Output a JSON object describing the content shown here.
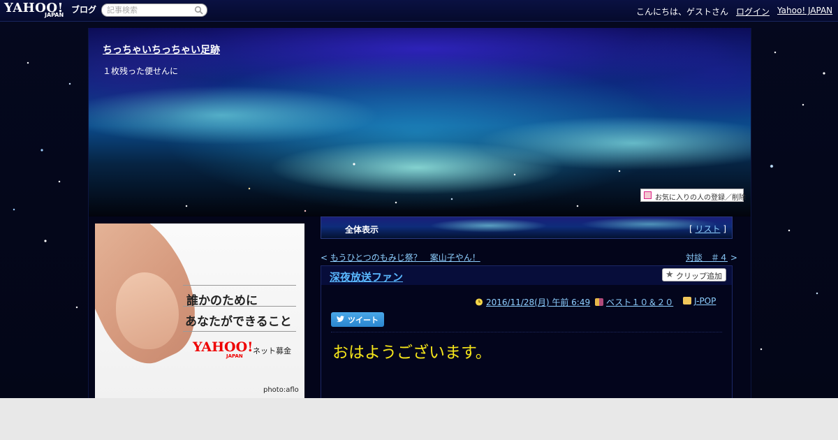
{
  "topbar": {
    "logo_text": "YAHOO!",
    "logo_sub": "JAPAN",
    "logo_blog": "ブログ",
    "search_placeholder": "記事検索",
    "greeting": "こんにちは、ゲストさん",
    "login": "ログイン",
    "yahoo_japan": "Yahoo! JAPAN"
  },
  "header": {
    "blog_title": "ちっちゃいちっちゃい足跡",
    "blog_subtitle": "１枚残った便せんに",
    "favorite_button": "お気に入りの人の登録／削除"
  },
  "ad": {
    "line1": "誰かのために",
    "line2": "あなたができること",
    "logo": "YAHOO!",
    "logo_sub": "JAPAN",
    "service": "ネット募金",
    "credit": "photo:aflo"
  },
  "nav": {
    "all_label": "全体表示",
    "list_open": "[",
    "list_label": "リスト",
    "list_close": "]"
  },
  "pager": {
    "prev_mark": "<",
    "prev": "もうひとつのもみじ祭？　案山子やん！",
    "next": "対談　＃４",
    "next_mark": ">"
  },
  "post": {
    "title": "深夜放送ファン",
    "clip_button": "クリップ追加",
    "date": "2016/11/28(月) 午前 6:49",
    "category": "ベスト１０＆２０",
    "genre": "J-POP",
    "tweet_button": "ツイート",
    "body_line1": "おはようございます。",
    "body_line2": "・・・・・"
  },
  "colors": {
    "link": "#8ecfff",
    "title_link": "#5ab8ff",
    "body_text": "#f5e51a",
    "topbar_bg": "#050a2c"
  }
}
